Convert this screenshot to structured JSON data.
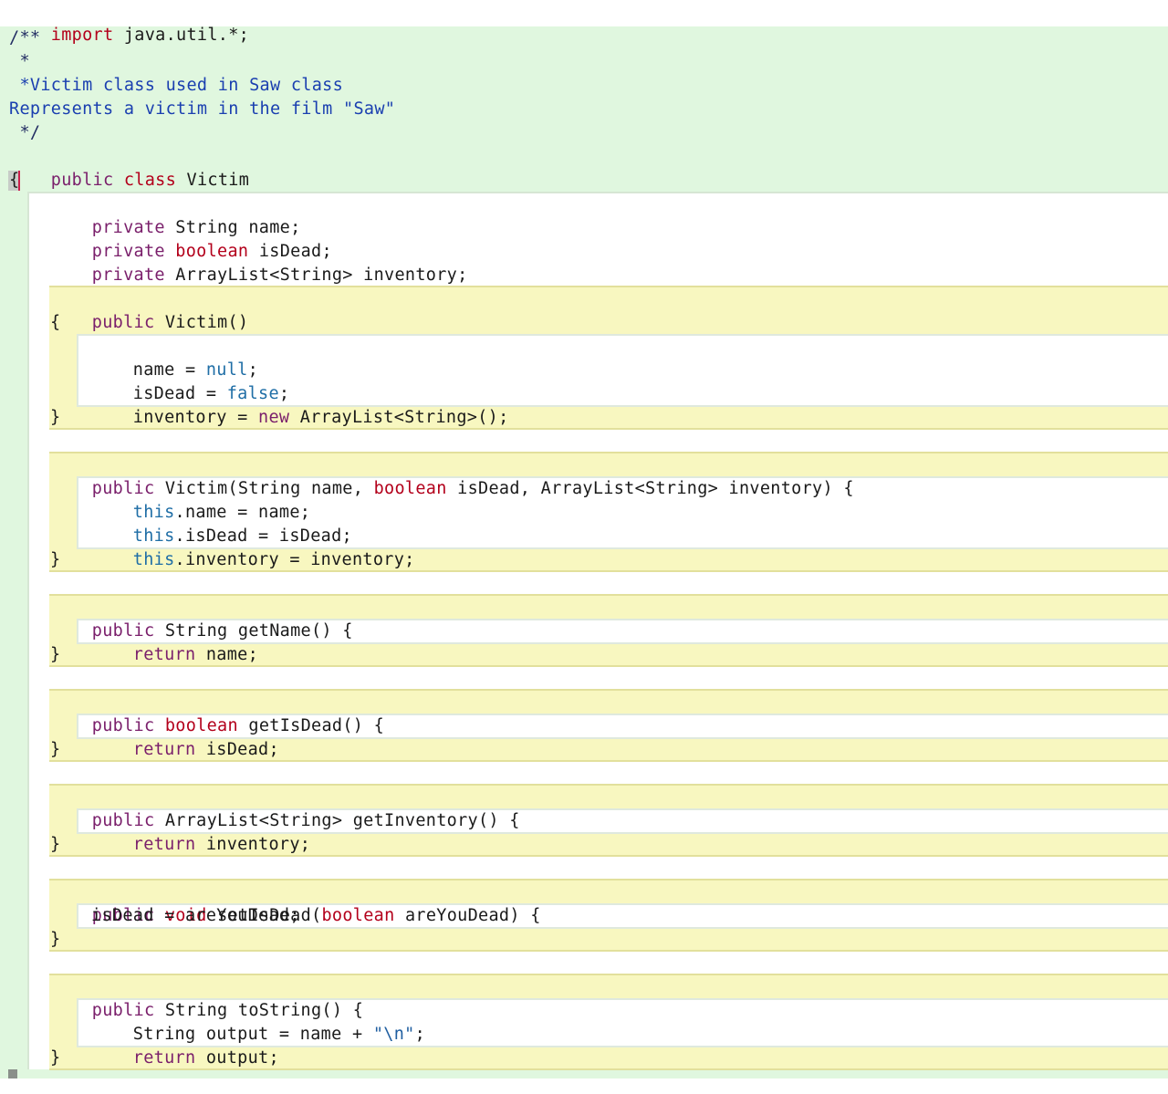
{
  "editor": {
    "lines": {
      "import": {
        "kw": "import",
        "rest": " java.util.*;"
      },
      "doc_open": "/**",
      "doc_star": " *",
      "doc_desc1": " *Victim class used in Saw class",
      "doc_desc2": "Represents a victim in the film \"Saw\"",
      "doc_close": " */",
      "class_decl": {
        "kw1": "public",
        "kw2": "class",
        "name": "Victim"
      },
      "class_open": "{",
      "field_name": {
        "kw": "private",
        "rest": " String name;"
      },
      "field_dead": {
        "kw": "private",
        "type": "boolean",
        "rest": " isDead;"
      },
      "field_inv": {
        "kw": "private",
        "rest": " ArrayList<String> inventory;"
      },
      "ctor1_decl": {
        "kw": "public",
        "rest": " Victim()"
      },
      "ctor1_open": "{",
      "ctor1_l1": {
        "pre": "name = ",
        "val": "null",
        "post": ";"
      },
      "ctor1_l2": {
        "pre": "isDead = ",
        "val": "false",
        "post": ";"
      },
      "ctor1_l3": {
        "pre": "inventory = ",
        "val": "new",
        "post": " ArrayList<String>();"
      },
      "ctor1_close": "}",
      "ctor2_decl": {
        "kw": "public",
        "a": " Victim(String name, ",
        "bool": "boolean",
        "b": " isDead, ArrayList<String> inventory) {"
      },
      "ctor2_l1": {
        "kw": "this",
        "rest": ".name = name;"
      },
      "ctor2_l2": {
        "kw": "this",
        "rest": ".isDead = isDead;"
      },
      "ctor2_l3": {
        "kw": "this",
        "rest": ".inventory = inventory;"
      },
      "ctor2_close": "}",
      "getname_decl": {
        "kw": "public",
        "rest": " String getName() {"
      },
      "getname_body": {
        "kw": "return",
        "rest": " name;"
      },
      "getname_close": "}",
      "getdead_decl": {
        "kw": "public",
        "type": "boolean",
        "rest": " getIsDead() {"
      },
      "getdead_body": {
        "kw": "return",
        "rest": " isDead;"
      },
      "getdead_close": "}",
      "getinv_decl": {
        "kw": "public",
        "rest": " ArrayList<String> getInventory() {"
      },
      "getinv_body": {
        "kw": "return",
        "rest": " inventory;"
      },
      "getinv_close": "}",
      "setdead_decl": {
        "kw": "public",
        "type": "void",
        "a": " setIsDead(",
        "bool": "boolean",
        "b": " areYouDead) {"
      },
      "setdead_body": "isDead = areYouDead;",
      "setdead_close": "}",
      "tostr_decl": {
        "kw": "public",
        "rest": " String toString() {"
      },
      "tostr_l1": {
        "pre": "String output = name + ",
        "str": "\"\\n\"",
        "post": ";"
      },
      "tostr_l2": {
        "kw": "return",
        "rest": " output;"
      },
      "tostr_close": "}"
    }
  }
}
